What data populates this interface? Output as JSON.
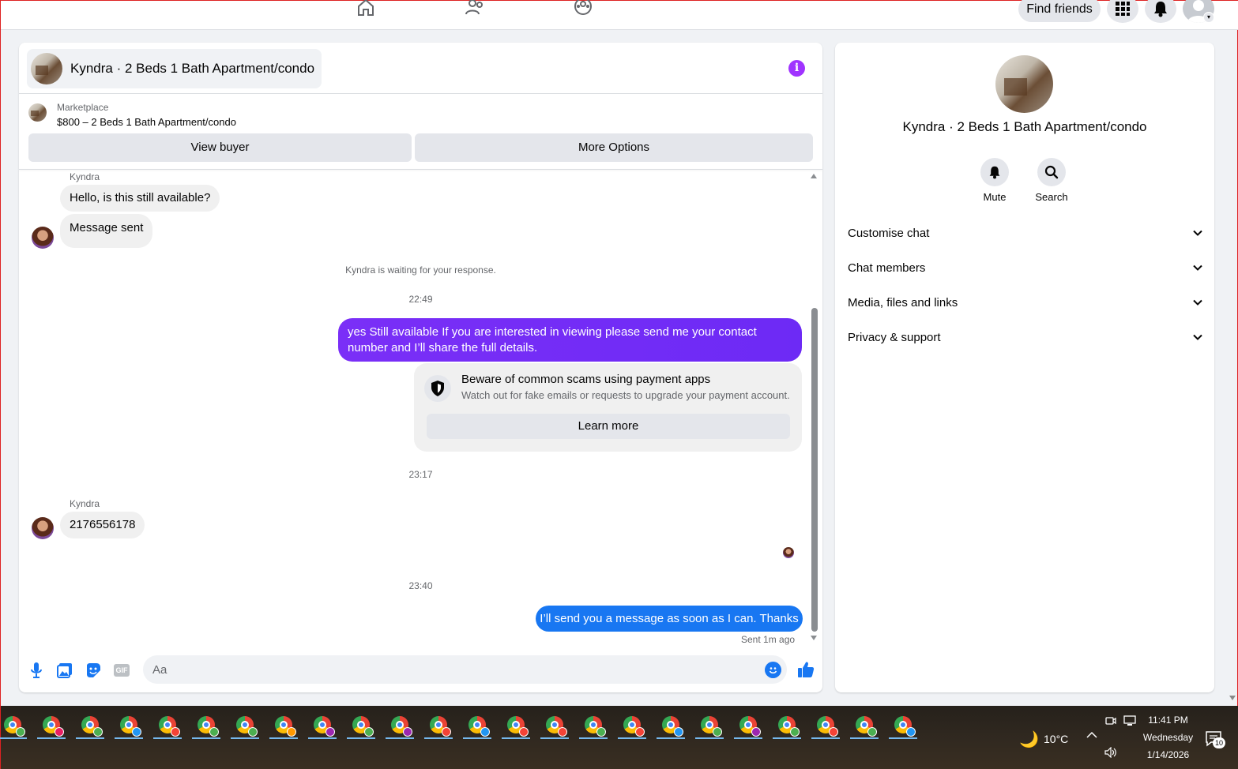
{
  "header": {
    "find_friends_label": "Find friends"
  },
  "chat": {
    "title": "Kyndra · 2 Beds 1 Bath Apartment/condo",
    "marketplace_label": "Marketplace",
    "listing": "$800 – 2 Beds 1 Bath Apartment/condo",
    "view_buyer_label": "View buyer",
    "more_options_label": "More Options",
    "messages": {
      "sender_1": "Kyndra",
      "incoming_1": "Hello, is this still available?",
      "incoming_2": "Message sent",
      "waiting_note": "Kyndra is waiting for your response.",
      "time_1": "22:49",
      "outgoing_1": "yes Still available If you are interested in viewing please send me your contact number and I’ll share the full details.",
      "scam_title": "Beware of common scams using payment apps",
      "scam_text": "Watch out for fake emails or requests to upgrade your payment account.",
      "learn_more_label": "Learn more",
      "time_2": "23:17",
      "sender_2": "Kyndra",
      "incoming_3": "2176556178",
      "time_3": "23:40",
      "outgoing_2": "I’ll send you a message as soon as I can. Thanks",
      "sent_status": "Sent 1m ago"
    },
    "composer": {
      "placeholder": "Aa",
      "gif_label": "GIF"
    }
  },
  "info_panel": {
    "title": "Kyndra · 2 Beds 1 Bath Apartment/condo",
    "mute_label": "Mute",
    "search_label": "Search",
    "sections": [
      "Customise chat",
      "Chat members",
      "Media, files and links",
      "Privacy & support"
    ]
  },
  "taskbar": {
    "temperature": "10°C",
    "time": "11:41 PM",
    "day": "Wednesday",
    "date": "1/14/2026",
    "notification_count": "10"
  },
  "colors": {
    "accent_purple": "#7a2ff7",
    "messenger_blue": "#1877f2",
    "info_icon": "#a033ff"
  },
  "icons": [
    "home-icon",
    "friends-icon",
    "groups-icon",
    "apps-grid-icon",
    "bell-icon",
    "info-icon",
    "shield-icon",
    "microphone-icon",
    "photo-icon",
    "sticker-icon",
    "gif-icon",
    "emoji-icon",
    "like-icon",
    "search-icon",
    "chevron-down-icon",
    "moon-icon",
    "notification-icon"
  ]
}
